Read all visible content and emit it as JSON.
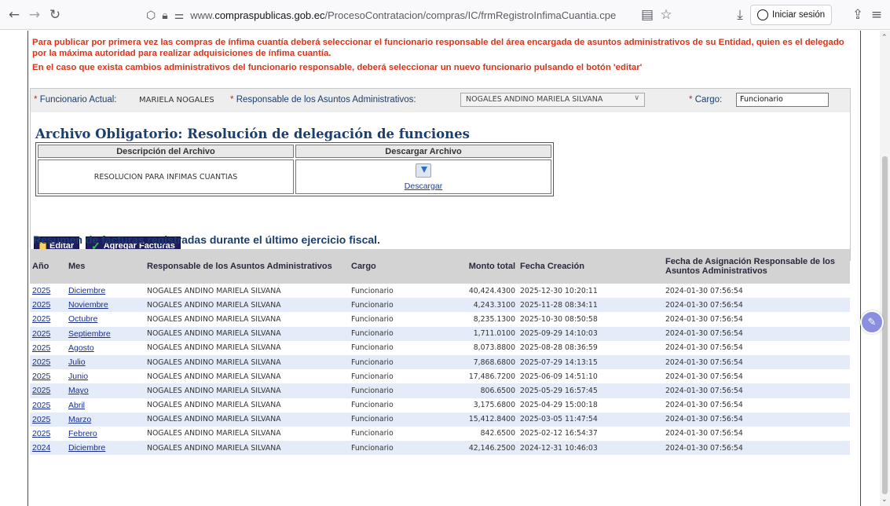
{
  "browser": {
    "url_prefix": "www.",
    "url_domain": "compraspublicas.gob.ec",
    "url_path": "/ProcesoContratacion/compras/IC/frmRegistroInfimaCuantia.cpe",
    "signin_label": "Iniciar sesión"
  },
  "notice": {
    "line1": "Para publicar por primera vez las compras de ínfima cuantía deberá seleccionar el funcionario responsable del área encargada de asuntos administrativos de su Entidad, quien es el delegado por la máxima autoridad para realizar adquisiciones de ínfima cuantía.",
    "line2": "En el caso que exista cambios administrativos del funcionario responsable, deberá seleccionar un nuevo funcionario pulsando el botón 'editar'"
  },
  "form": {
    "asterisk": "*",
    "funcionario_label": "Funcionario Actual:",
    "funcionario_value": "MARIELA NOGALES",
    "responsable_label": "Responsable de los Asuntos Administrativos:",
    "responsable_selected": "NOGALES ANDINO MARIELA SILVANA",
    "cargo_label": "Cargo:",
    "cargo_value": "Funcionario"
  },
  "archivo": {
    "title": "Archivo Obligatorio: Resolución de delegación de funciones",
    "col_descripcion": "Descripción del Archivo",
    "col_descargar": "Descargar Archivo",
    "file_description": "RESOLUCION PARA INFIMAS CUANTIAS",
    "download_link": "Descargar"
  },
  "buttons": {
    "editar": "Editar",
    "agregar": "Agregar Facturas"
  },
  "resumen": {
    "title": "Resumen de facturas registradas durante el último ejercicio fiscal.",
    "headers": {
      "anio": "Año",
      "mes": "Mes",
      "responsable": "Responsable de los Asuntos Administrativos",
      "cargo": "Cargo",
      "monto": "Monto total",
      "fecha_creacion": "Fecha Creación",
      "fecha_asignacion": "Fecha de Asignación Responsable de los Asuntos Administrativos"
    },
    "rows": [
      {
        "anio": "2025",
        "mes": "Diciembre",
        "responsable": "NOGALES ANDINO MARIELA SILVANA",
        "cargo": "Funcionario",
        "monto": "40,424.4300",
        "fecha_creacion": "2025-12-30 10:20:11",
        "fecha_asignacion": "2024-01-30 07:56:54"
      },
      {
        "anio": "2025",
        "mes": "Noviembre",
        "responsable": "NOGALES ANDINO MARIELA SILVANA",
        "cargo": "Funcionario",
        "monto": "4,243.3100",
        "fecha_creacion": "2025-11-28 08:34:11",
        "fecha_asignacion": "2024-01-30 07:56:54"
      },
      {
        "anio": "2025",
        "mes": "Octubre",
        "responsable": "NOGALES ANDINO MARIELA SILVANA",
        "cargo": "Funcionario",
        "monto": "8,235.1300",
        "fecha_creacion": "2025-10-30 08:50:58",
        "fecha_asignacion": "2024-01-30 07:56:54"
      },
      {
        "anio": "2025",
        "mes": "Septiembre",
        "responsable": "NOGALES ANDINO MARIELA SILVANA",
        "cargo": "Funcionario",
        "monto": "1,711.0100",
        "fecha_creacion": "2025-09-29 14:10:03",
        "fecha_asignacion": "2024-01-30 07:56:54"
      },
      {
        "anio": "2025",
        "mes": "Agosto",
        "responsable": "NOGALES ANDINO MARIELA SILVANA",
        "cargo": "Funcionario",
        "monto": "8,073.8800",
        "fecha_creacion": "2025-08-28 08:36:59",
        "fecha_asignacion": "2024-01-30 07:56:54"
      },
      {
        "anio": "2025",
        "mes": "Julio",
        "responsable": "NOGALES ANDINO MARIELA SILVANA",
        "cargo": "Funcionario",
        "monto": "7,868.6800",
        "fecha_creacion": "2025-07-29 14:13:15",
        "fecha_asignacion": "2024-01-30 07:56:54"
      },
      {
        "anio": "2025",
        "mes": "Junio",
        "responsable": "NOGALES ANDINO MARIELA SILVANA",
        "cargo": "Funcionario",
        "monto": "17,486.7200",
        "fecha_creacion": "2025-06-09 14:51:10",
        "fecha_asignacion": "2024-01-30 07:56:54"
      },
      {
        "anio": "2025",
        "mes": "Mayo",
        "responsable": "NOGALES ANDINO MARIELA SILVANA",
        "cargo": "Funcionario",
        "monto": "806.6500",
        "fecha_creacion": "2025-05-29 16:57:45",
        "fecha_asignacion": "2024-01-30 07:56:54"
      },
      {
        "anio": "2025",
        "mes": "Abril",
        "responsable": "NOGALES ANDINO MARIELA SILVANA",
        "cargo": "Funcionario",
        "monto": "3,175.6800",
        "fecha_creacion": "2025-04-29 15:00:18",
        "fecha_asignacion": "2024-01-30 07:56:54"
      },
      {
        "anio": "2025",
        "mes": "Marzo",
        "responsable": "NOGALES ANDINO MARIELA SILVANA",
        "cargo": "Funcionario",
        "monto": "15,412.8400",
        "fecha_creacion": "2025-03-05 11:47:54",
        "fecha_asignacion": "2024-01-30 07:56:54"
      },
      {
        "anio": "2025",
        "mes": "Febrero",
        "responsable": "NOGALES ANDINO MARIELA SILVANA",
        "cargo": "Funcionario",
        "monto": "842.6500",
        "fecha_creacion": "2025-02-12 16:54:37",
        "fecha_asignacion": "2024-01-30 07:56:54"
      },
      {
        "anio": "2024",
        "mes": "Diciembre",
        "responsable": "NOGALES ANDINO MARIELA SILVANA",
        "cargo": "Funcionario",
        "monto": "42,146.2500",
        "fecha_creacion": "2024-12-31 10:46:03",
        "fecha_asignacion": "2024-01-30 07:56:54"
      }
    ]
  },
  "colors": {
    "notice_red": "#d9331a",
    "title_blue": "#1a3e6e",
    "button_navy": "#1c1c5e",
    "row_alt": "#e3ecf8"
  }
}
